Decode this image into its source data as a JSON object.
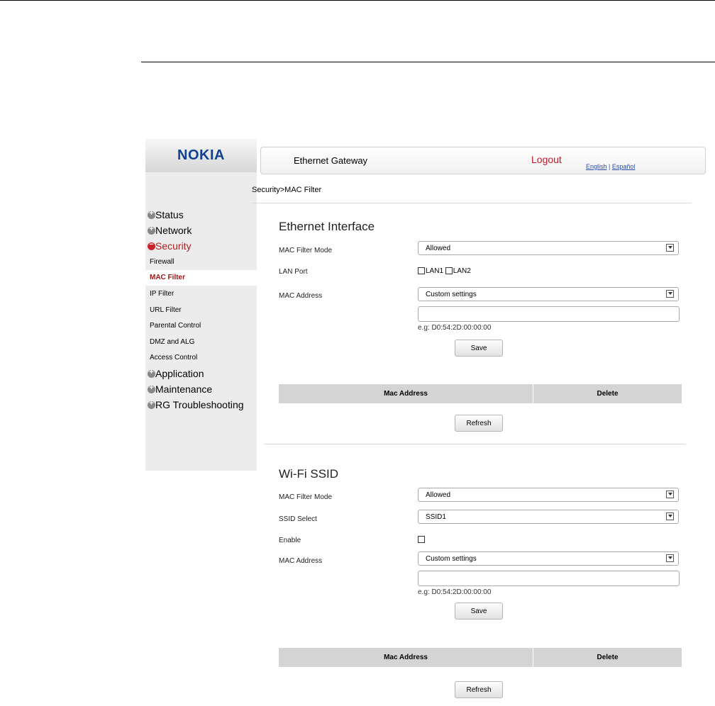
{
  "brand": "NOKIA",
  "header": {
    "title": "Ethernet Gateway",
    "logout": "Logout",
    "lang_en": "English",
    "lang_sep": " | ",
    "lang_es": "Español"
  },
  "breadcrumb": "Security>MAC Filter",
  "sidebar": {
    "items": [
      {
        "label": "Status"
      },
      {
        "label": "Network"
      },
      {
        "label": "Security"
      },
      {
        "label": "Application"
      },
      {
        "label": "Maintenance"
      },
      {
        "label": "RG Troubleshooting"
      }
    ],
    "security_sub": [
      "Firewall",
      "MAC Filter",
      "IP Filter",
      "URL Filter",
      "Parental Control",
      "DMZ and ALG",
      "Access Control"
    ]
  },
  "ethernet": {
    "title": "Ethernet Interface",
    "mode_label": "MAC Filter Mode",
    "mode_value": "Allowed",
    "lan_label": "LAN Port",
    "lan1": "LAN1",
    "lan2": "LAN2",
    "mac_label": "MAC Address",
    "mac_select": "Custom settings",
    "hint": "e.g: D0:54:2D:00:00:00",
    "save": "Save",
    "col_mac": "Mac Address",
    "col_delete": "Delete",
    "refresh": "Refresh"
  },
  "wifi": {
    "title": "Wi-Fi SSID",
    "mode_label": "MAC Filter Mode",
    "mode_value": "Allowed",
    "ssid_label": "SSID Select",
    "ssid_value": "SSID1",
    "enable_label": "Enable",
    "mac_label": "MAC Address",
    "mac_select": "Custom settings",
    "hint": "e.g: D0:54:2D:00:00:00",
    "save": "Save",
    "col_mac": "Mac Address",
    "col_delete": "Delete",
    "refresh": "Refresh"
  }
}
